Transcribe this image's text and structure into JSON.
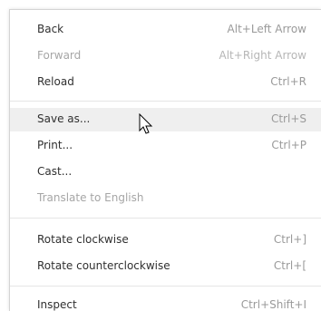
{
  "menu": {
    "items": [
      {
        "label": "Back",
        "shortcut": "Alt+Left Arrow"
      },
      {
        "label": "Forward",
        "shortcut": "Alt+Right Arrow"
      },
      {
        "label": "Reload",
        "shortcut": "Ctrl+R"
      },
      {
        "label": "Save as...",
        "shortcut": "Ctrl+S"
      },
      {
        "label": "Print...",
        "shortcut": "Ctrl+P"
      },
      {
        "label": "Cast...",
        "shortcut": ""
      },
      {
        "label": "Translate to English",
        "shortcut": ""
      },
      {
        "label": "Rotate clockwise",
        "shortcut": "Ctrl+]"
      },
      {
        "label": "Rotate counterclockwise",
        "shortcut": "Ctrl+["
      },
      {
        "label": "Inspect",
        "shortcut": "Ctrl+Shift+I"
      }
    ]
  },
  "colors": {
    "text": "#303030",
    "disabled_text": "#a6a6a6",
    "shortcut_text": "#9a9a9a",
    "highlight": "#efefef",
    "separator": "#e6e6e6"
  },
  "icons": {
    "cursor": "mouse-pointer-icon"
  }
}
